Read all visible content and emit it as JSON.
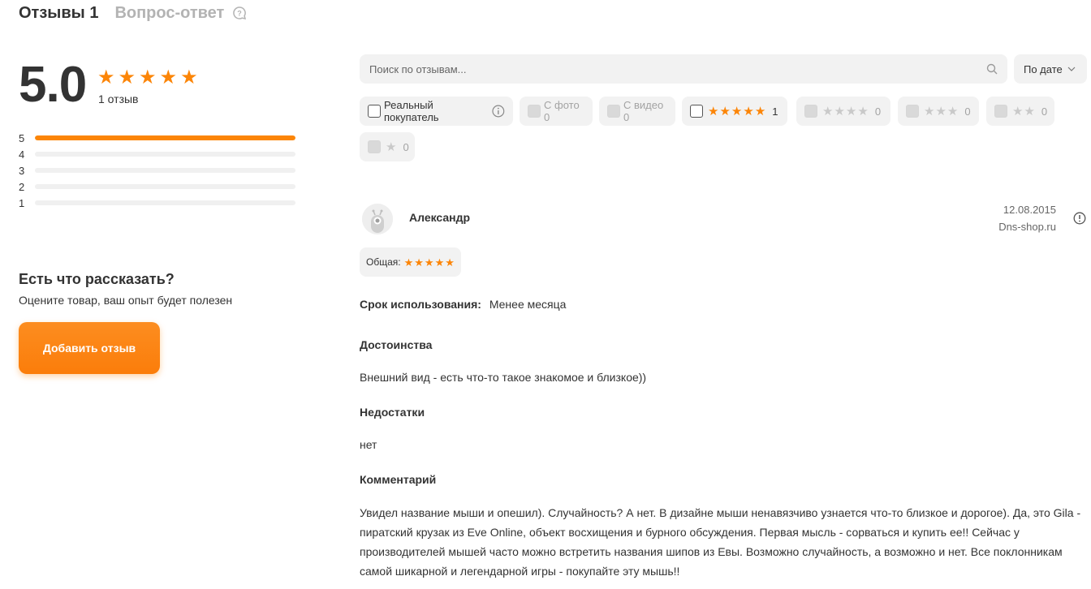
{
  "tabs": {
    "reviews_label": "Отзывы",
    "reviews_count": "1",
    "qa_label": "Вопрос-ответ"
  },
  "summary": {
    "rating": "5.0",
    "stars_filled": 5,
    "review_count_text": "1 отзыв",
    "distribution": [
      {
        "stars": "5",
        "share": 1.0
      },
      {
        "stars": "4",
        "share": 0
      },
      {
        "stars": "3",
        "share": 0
      },
      {
        "stars": "2",
        "share": 0
      },
      {
        "stars": "1",
        "share": 0
      }
    ]
  },
  "cta": {
    "title": "Есть что рассказать?",
    "subtitle": "Оцените товар, ваш опыт будет полезен",
    "button_label": "Добавить отзыв"
  },
  "search": {
    "placeholder": "Поиск по отзывам...",
    "value": ""
  },
  "sort": {
    "selected": "По дате"
  },
  "filters": {
    "real_buyer": "Реальный покупатель",
    "with_photo": "С фото 0",
    "with_video": "С видео 0",
    "star_filters": [
      {
        "stars": 5,
        "count": "1",
        "enabled": true
      },
      {
        "stars": 4,
        "count": "0",
        "enabled": false
      },
      {
        "stars": 3,
        "count": "0",
        "enabled": false
      },
      {
        "stars": 2,
        "count": "0",
        "enabled": false
      },
      {
        "stars": 1,
        "count": "0",
        "enabled": false
      }
    ]
  },
  "review": {
    "author": "Александр",
    "date": "12.08.2015",
    "source": "Dns-shop.ru",
    "overall_label": "Общая:",
    "overall_stars": 5,
    "usage_label": "Срок использования:",
    "usage_value": "Менее месяца",
    "pros_title": "Достоинства",
    "pros_text": "Внешний вид - есть что-то такое знакомое и близкое))",
    "cons_title": "Недостатки",
    "cons_text": "нет",
    "comment_title": "Комментарий",
    "comment_text": "Увидел название мыши и опешил). Случайность? А нет. В дизайне мыши ненавязчиво узнается что-то близкое и дорогое). Да, это Gila - пиратский крузак из Eve Online, объект восхищения и бурного обсуждения. Первая мысль - сорваться и купить ее!! Сейчас у производителей мышей часто можно встретить названия шипов из Евы. Возможно случайность, а возможно и нет. Все поклонникам самой шикарной и легендарной игры - покупайте эту мышь!!"
  },
  "colors": {
    "accent": "#fc8507",
    "chip_bg": "#f2f2f2",
    "text": "#333333",
    "muted": "#b3b3b3"
  }
}
